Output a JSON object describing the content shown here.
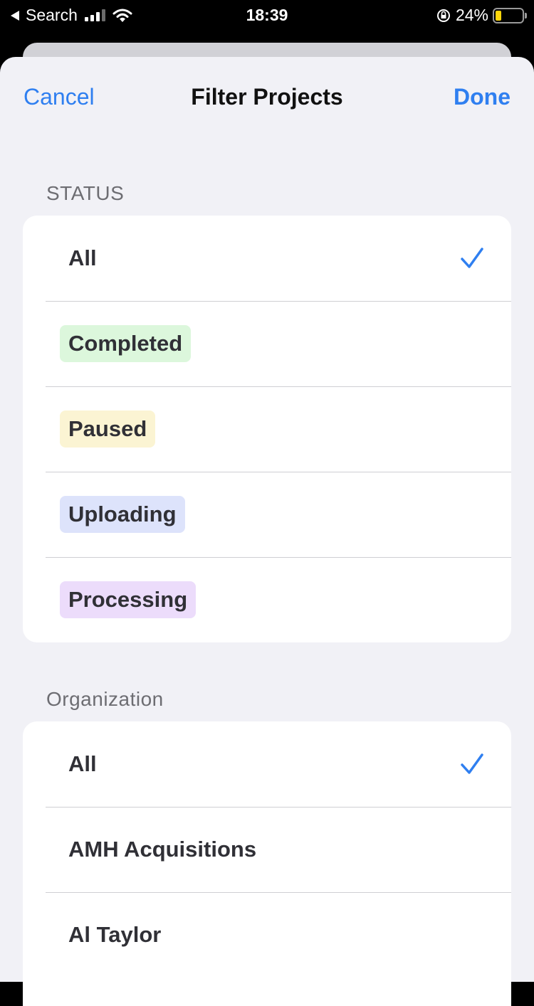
{
  "status_bar": {
    "back_label": "Search",
    "time": "18:39",
    "battery": "24%",
    "battery_level": 0.24
  },
  "nav": {
    "cancel": "Cancel",
    "title": "Filter Projects",
    "done": "Done"
  },
  "status_section": {
    "header": "STATUS",
    "items": [
      {
        "label": "All",
        "selected": true
      },
      {
        "label": "Completed",
        "color": "#dcf7dc"
      },
      {
        "label": "Paused",
        "color": "#fbf4d3"
      },
      {
        "label": "Uploading",
        "color": "#dde3fb"
      },
      {
        "label": "Processing",
        "color": "#ecdcfb"
      }
    ]
  },
  "org_section": {
    "header": "Organization",
    "items": [
      {
        "label": "All",
        "selected": true
      },
      {
        "label": "AMH Acquisitions"
      },
      {
        "label": "Al Taylor"
      }
    ]
  },
  "accent_color": "#2f7ff0"
}
